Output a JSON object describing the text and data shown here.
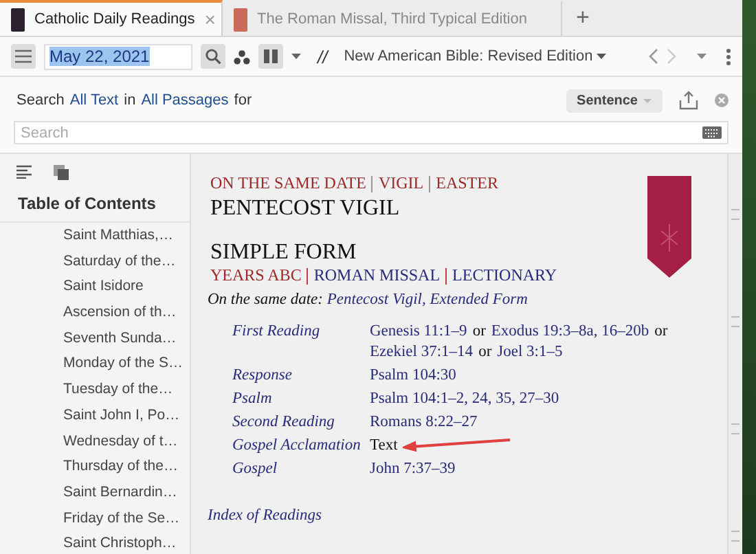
{
  "tabs": [
    {
      "label": "Catholic Daily Readings",
      "selected": true,
      "close": "×"
    },
    {
      "label": "The Roman Missal, Third Typical Edition",
      "selected": false
    }
  ],
  "new_tab": "+",
  "toolbar": {
    "date": "May 22, 2021",
    "parallel": "//",
    "version": "New American Bible: Revised Edition"
  },
  "search": {
    "prefix": "Search",
    "scope": "All Text",
    "middle": "in",
    "range": "All Passages",
    "suffix": "for",
    "mode": "Sentence",
    "placeholder": "Search"
  },
  "sidebar": {
    "title": "Table of Contents",
    "items": [
      "Saint Matthias,…",
      "Saturday of the…",
      "Saint Isidore",
      "Ascension of th…",
      "Seventh Sunda…",
      "Monday of the S…",
      "Tuesday of the…",
      "Saint John I, Po…",
      "Wednesday of t…",
      "Thursday of the…",
      "Saint Bernardin…",
      "Friday of the Se…",
      "Saint Christoph…"
    ]
  },
  "document": {
    "kicker": {
      "separator": {
        "color": "#999999"
      },
      "items": [
        {
          "text": "ON THE SAME DATE",
          "color": "#9b2a2a"
        },
        {
          "text": "VIGIL",
          "color": "#9b2a2a"
        },
        {
          "text": "EASTER",
          "color": "#9b2a2a"
        }
      ]
    },
    "title": "PENTECOST VIGIL",
    "subtitle": "SIMPLE FORM",
    "sources": {
      "separator": {
        "color": "#c04040"
      },
      "items": [
        {
          "text": "YEARS ABC",
          "color": "#9b2a2a"
        },
        {
          "text": "ROMAN MISSAL",
          "color": "#2a2a7a"
        },
        {
          "text": "LECTIONARY",
          "color": "#2a2a7a"
        }
      ]
    },
    "same_date": {
      "label": "On the same date:",
      "link": "Pentecost Vigil, Extended Form"
    },
    "readings": [
      {
        "label": "First Reading",
        "parts": [
          {
            "text": "Genesis 11:1–9",
            "link": true
          },
          {
            "text": "or",
            "link": false
          },
          {
            "text": "Exodus 19:3–8a, 16–20b",
            "link": true
          },
          {
            "text": "or",
            "link": false
          },
          {
            "text": "Ezekiel 37:1–14",
            "link": true
          },
          {
            "text": "or",
            "link": false
          },
          {
            "text": "Joel 3:1–5",
            "link": true
          }
        ]
      },
      {
        "label": "Response",
        "parts": [
          {
            "text": "Psalm 104:30",
            "link": true
          }
        ]
      },
      {
        "label": "Psalm",
        "parts": [
          {
            "text": "Psalm 104:1–2, 24, 35, 27–30",
            "link": true
          }
        ]
      },
      {
        "label": "Second Reading",
        "parts": [
          {
            "text": "Romans 8:22–27",
            "link": true
          }
        ]
      },
      {
        "label": "Gospel Acclamation",
        "parts": [
          {
            "text": "Text",
            "link": false
          }
        ],
        "arrow": true
      },
      {
        "label": "Gospel",
        "parts": [
          {
            "text": "John 7:37–39",
            "link": true
          }
        ]
      }
    ],
    "index_link": "Index of Readings"
  }
}
